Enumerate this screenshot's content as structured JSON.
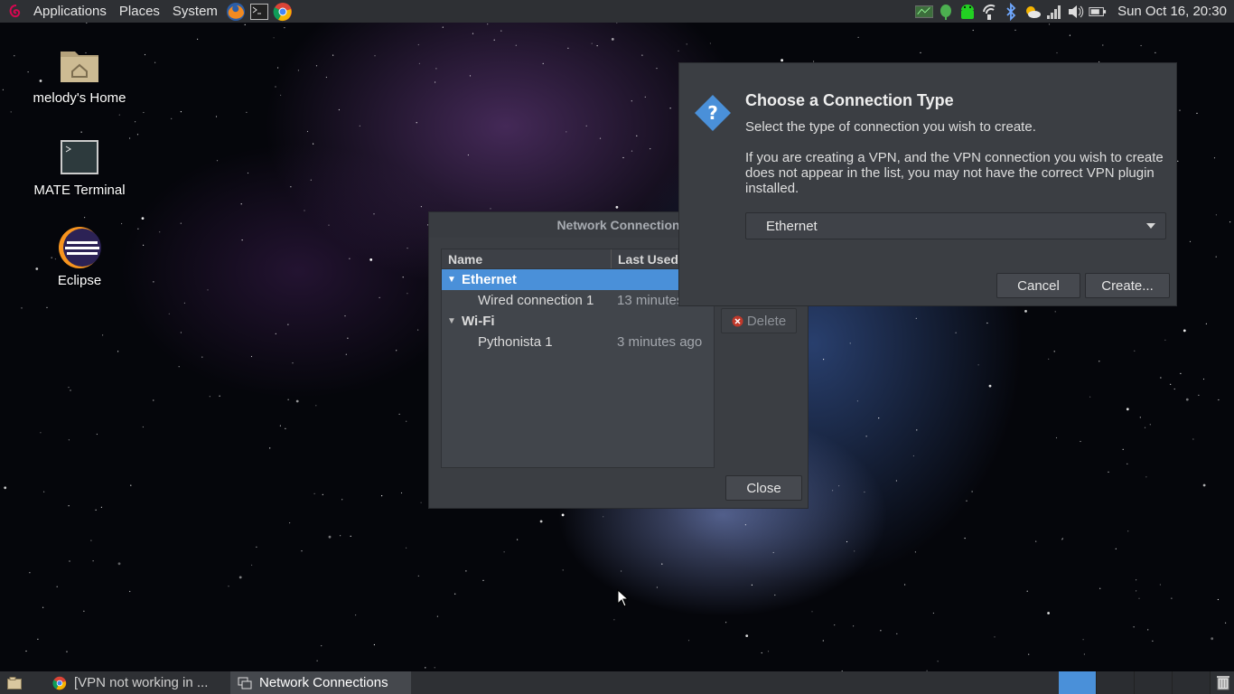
{
  "top_panel": {
    "menus": [
      "Applications",
      "Places",
      "System"
    ],
    "clock": "Sun Oct 16, 20:30"
  },
  "desktop_icons": [
    {
      "label": "melody's Home"
    },
    {
      "label": "MATE Terminal"
    },
    {
      "label": "Eclipse"
    }
  ],
  "network_connections": {
    "title": "Network Connection",
    "columns": {
      "name": "Name",
      "last_used": "Last Used"
    },
    "groups": [
      {
        "name": "Ethernet",
        "connections": [
          {
            "name": "Wired connection 1",
            "last_used": "13 minutes"
          }
        ]
      },
      {
        "name": "Wi-Fi",
        "connections": [
          {
            "name": "Pythonista 1",
            "last_used": "3 minutes ago"
          }
        ]
      }
    ],
    "delete_label": "Delete",
    "close_label": "Close"
  },
  "dialog": {
    "title": "Choose a Connection Type",
    "line1": "Select the type of connection you wish to create.",
    "line2": "If you are creating a VPN, and the VPN connection you wish to create does not appear in the list, you may not have the correct VPN plugin installed.",
    "selected_type": "Ethernet",
    "cancel_label": "Cancel",
    "create_label": "Create..."
  },
  "taskbar": {
    "tasks": [
      {
        "label": "[VPN not working in ..."
      },
      {
        "label": "Network Connections"
      }
    ]
  },
  "colors": {
    "accent": "#4a90d9",
    "panel": "#2e3034",
    "window": "#3b3e43"
  },
  "icons": {
    "menu_logo": "debian-swirl-icon",
    "launchers": [
      "firefox-icon",
      "terminal-icon",
      "chrome-icon"
    ],
    "tray": [
      "network-monitor-icon",
      "green-leaf-icon",
      "android-icon",
      "wifi-tray-icon",
      "bluetooth-icon",
      "weather-icon",
      "signal-bars-icon",
      "volume-icon",
      "battery-icon"
    ]
  }
}
